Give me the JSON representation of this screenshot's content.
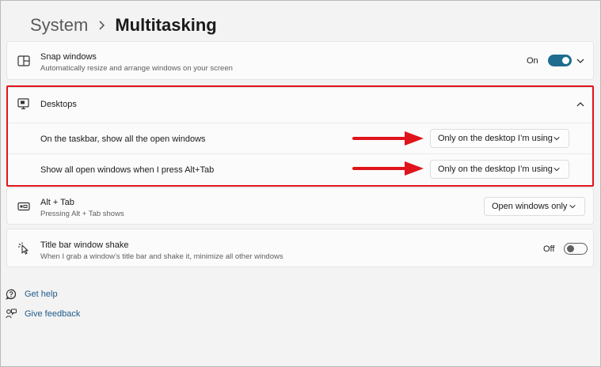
{
  "breadcrumb": {
    "parent": "System",
    "current": "Multitasking"
  },
  "snap_windows": {
    "icon": "snap-windows-icon",
    "title": "Snap windows",
    "description": "Automatically resize and arrange windows on your screen",
    "state_label": "On",
    "state": true
  },
  "desktops": {
    "icon": "desktops-icon",
    "title": "Desktops",
    "taskbar": {
      "label": "On the taskbar, show all the open windows",
      "value": "Only on the desktop I’m using"
    },
    "alt_tab_windows": {
      "label": "Show all open windows when I press Alt+Tab",
      "value": "Only on the desktop I’m using"
    }
  },
  "alt_tab": {
    "icon": "alt-tab-icon",
    "title": "Alt + Tab",
    "description": "Pressing Alt + Tab shows",
    "value": "Open windows only"
  },
  "title_bar_shake": {
    "icon": "window-shake-icon",
    "title": "Title bar window shake",
    "description": "When I grab a window’s title bar and shake it, minimize all other windows",
    "state_label": "Off",
    "state": false
  },
  "links": {
    "help": "Get help",
    "feedback": "Give feedback"
  },
  "colors": {
    "accent": "#1e6c8e",
    "annotation": "#e0141b",
    "link": "#1e5a8a"
  }
}
